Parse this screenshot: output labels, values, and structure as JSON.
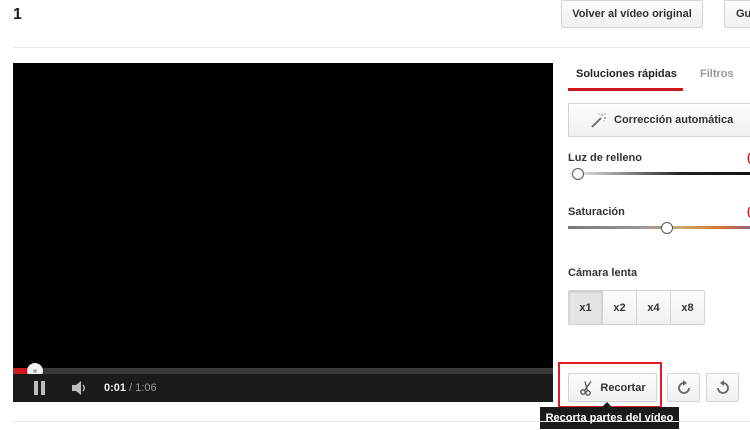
{
  "header": {
    "video_title": "1",
    "revert_label": "Volver al vídeo original",
    "save_label_partial": "Gu"
  },
  "player": {
    "current_time": "0:01",
    "time_separator": "/",
    "duration": "1:06",
    "progress_fraction": 0.04
  },
  "tabs": {
    "quick_fixes": "Soluciones rápidas",
    "filters": "Filtros",
    "active": "quick_fixes"
  },
  "quick_fixes": {
    "auto_fix_label": "Corrección automática",
    "fill_light_label": "Luz de relleno",
    "fill_light_value_fraction": 0.02,
    "saturation_label": "Saturación",
    "saturation_value_fraction": 0.49,
    "slow_motion_label": "Cámara lenta",
    "speeds": [
      "x1",
      "x2",
      "x4",
      "x8"
    ],
    "selected_speed": "x1",
    "trim_label": "Recortar",
    "trim_tooltip": "Recorta partes del vídeo"
  },
  "colors": {
    "accent": "#cc181e",
    "highlight": "#e01b24",
    "player_bg": "#000000"
  },
  "icons": [
    "pause-icon",
    "volume-icon",
    "magic-wand-icon",
    "scissors-icon",
    "rotate-right-icon",
    "rotate-left-icon"
  ]
}
